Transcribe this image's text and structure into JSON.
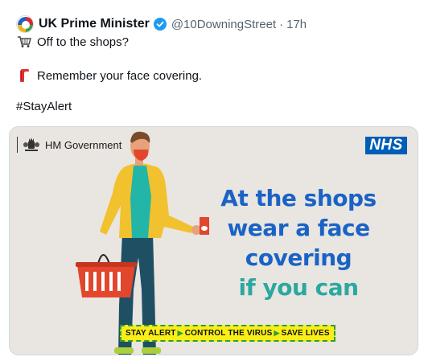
{
  "tweet": {
    "display_name": "UK Prime Minister",
    "handle": "@10DowningStreet",
    "separator": "·",
    "time": "17h",
    "lines": [
      {
        "emoji": "shopping-cart-icon",
        "text": "Off to the shops?"
      },
      {
        "emoji": "face-covering-icon",
        "text": "Remember your face covering."
      },
      {
        "emoji": "",
        "text": "#StayAlert"
      }
    ]
  },
  "media": {
    "gov_label": "HM Government",
    "nhs_logo": "NHS",
    "headline": {
      "line1": "At the shops",
      "line2": "wear a face",
      "line3": "covering",
      "line4": "if you can"
    },
    "slogan": {
      "part1": "STAY ALERT",
      "part2": "CONTROL THE VIRUS",
      "part3": "SAVE LIVES"
    }
  },
  "colors": {
    "verified": "#1d9bf0",
    "nhs_blue": "#005eb8",
    "headline_blue": "#1a63c6",
    "headline_teal": "#2ba8a0",
    "slogan_yellow": "#f9ee17",
    "slogan_green": "#2d9e3c",
    "media_background": "#e9e5e0"
  }
}
